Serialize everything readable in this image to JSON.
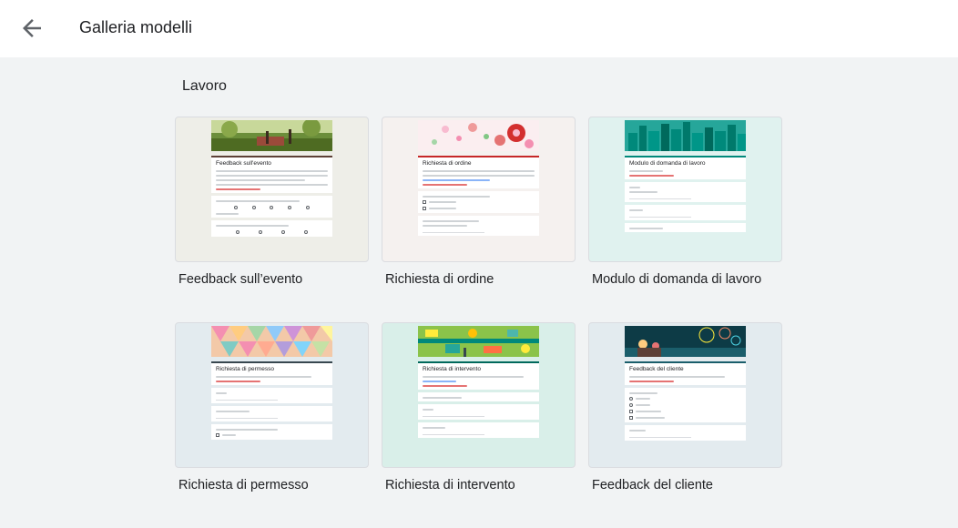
{
  "header": {
    "title": "Galleria modelli",
    "back_icon": "arrow-back-icon"
  },
  "section": {
    "title": "Lavoro"
  },
  "templates": [
    {
      "label": "Feedback sull’evento",
      "form_title": "Feedback sull'evento",
      "preview_bg": "#eeeee8",
      "accent": "#5d4037",
      "banner": "park-photo"
    },
    {
      "label": "Richiesta di ordine",
      "form_title": "Richiesta di ordine",
      "preview_bg": "#f5f1ef",
      "accent": "#c62828",
      "banner": "floral-illustration"
    },
    {
      "label": "Modulo di domanda di lavoro",
      "form_title": "Modulo di domanda di lavoro",
      "preview_bg": "#e0f2ef",
      "accent": "#00897b",
      "banner": "city-skyline"
    },
    {
      "label": "Richiesta di permesso",
      "form_title": "Richiesta di permesso",
      "preview_bg": "#e3ebef",
      "accent": "#37474f",
      "banner": "color-mosaic"
    },
    {
      "label": "Richiesta di intervento",
      "form_title": "Richiesta di intervento",
      "preview_bg": "#d9efe9",
      "accent": "#00695c",
      "banner": "tools-illustration"
    },
    {
      "label": "Feedback del cliente",
      "form_title": "Feedback del cliente",
      "preview_bg": "#e3ebef",
      "accent": "#1a5e6b",
      "banner": "fireworks-illustration"
    }
  ]
}
